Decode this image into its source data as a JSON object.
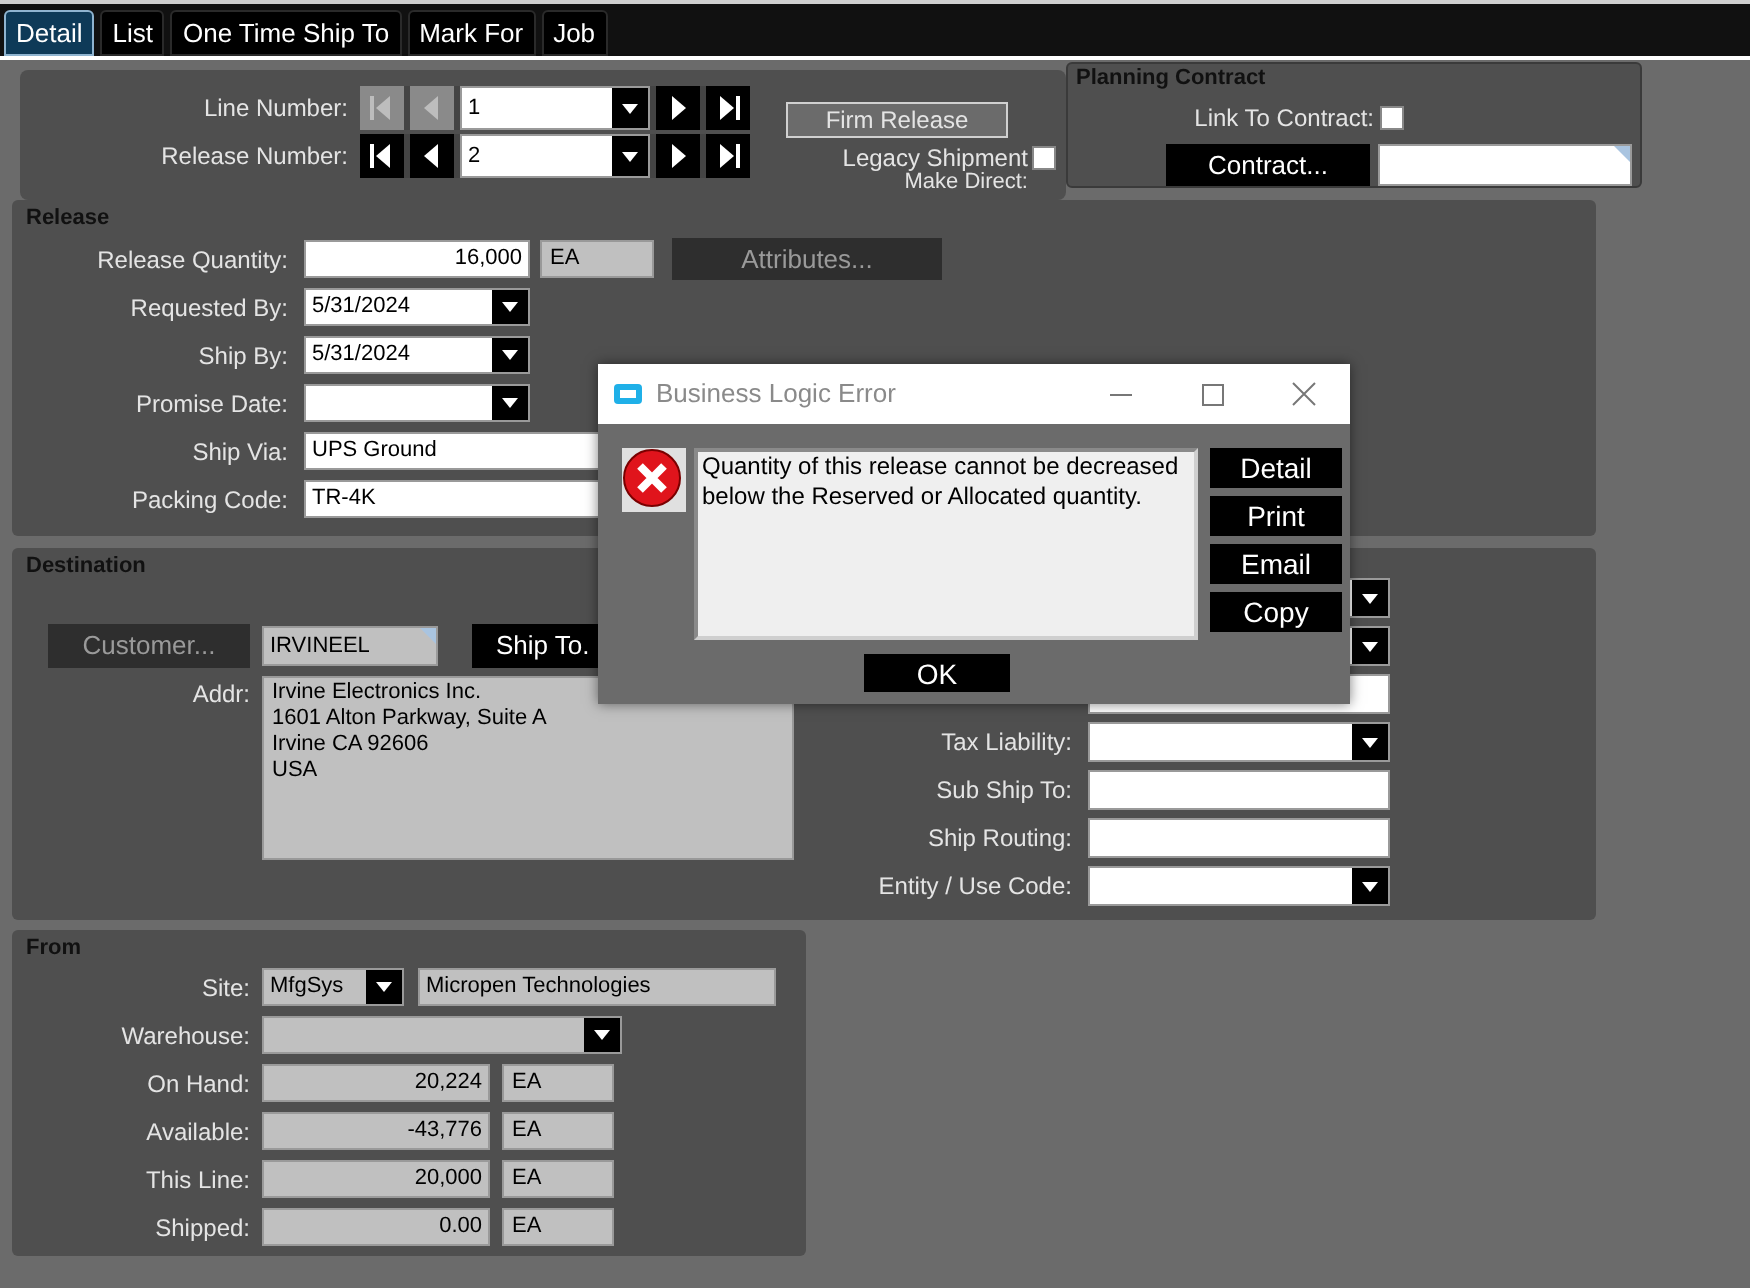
{
  "tabs": [
    {
      "label": "Detail",
      "selected": true
    },
    {
      "label": "List",
      "selected": false
    },
    {
      "label": "One Time Ship To",
      "selected": false
    },
    {
      "label": "Mark For",
      "selected": false
    },
    {
      "label": "Job",
      "selected": false
    }
  ],
  "header": {
    "navigators": [
      {
        "label": "Line Number:",
        "value": "1",
        "first_disabled": true
      },
      {
        "label": "Release Number:",
        "value": "2",
        "first_disabled": false
      }
    ],
    "firm_release_button": "Firm Release",
    "legacy_shipment": {
      "label": "Legacy Shipment",
      "checked": false
    },
    "make_direct_label": "Make Direct:"
  },
  "planning_contract": {
    "title": "Planning Contract",
    "link_to_contract": {
      "label": "Link To Contract:",
      "checked": false
    },
    "contract_button": "Contract..."
  },
  "release": {
    "title": "Release",
    "attributes_button": {
      "label": "Attributes...",
      "disabled": true
    },
    "rows": [
      {
        "kind": "quantity",
        "label": "Release Quantity:",
        "value": "16,000",
        "unit": "EA"
      },
      {
        "kind": "combo",
        "label": "Requested By:",
        "value": "5/31/2024"
      },
      {
        "kind": "combo",
        "label": "Ship By:",
        "value": "5/31/2024"
      },
      {
        "kind": "combo",
        "label": "Promise Date:"
      },
      {
        "kind": "text",
        "label": "Ship Via:",
        "value": "UPS Ground"
      },
      {
        "kind": "text",
        "label": "Packing Code:",
        "value": "TR-4K"
      }
    ]
  },
  "destination": {
    "title": "Destination",
    "customer_button": {
      "label": "Customer...",
      "disabled": true
    },
    "customer_id": "IRVINEEL",
    "ship_to_button": "Ship To.",
    "address_label": "Addr:",
    "address": [
      "Irvine Electronics Inc.",
      "1601 Alton Parkway, Suite A",
      "Irvine CA 92606",
      "USA"
    ],
    "right_fields": [
      {
        "kind": "combo"
      },
      {
        "kind": "combo"
      },
      {
        "kind": "text"
      },
      {
        "kind": "combo",
        "label": "Tax Liability:"
      },
      {
        "kind": "text",
        "label": "Sub Ship To:"
      },
      {
        "kind": "text",
        "label": "Ship Routing:"
      },
      {
        "kind": "combo",
        "label": "Entity / Use Code:"
      }
    ]
  },
  "from": {
    "title": "From",
    "site": {
      "label": "Site:",
      "value": "MfgSys",
      "name": "Micropen Technologies"
    },
    "warehouse_label": "Warehouse:",
    "quantities": [
      {
        "label": "On Hand:",
        "value": "20,224",
        "unit": "EA"
      },
      {
        "label": "Available:",
        "value": "-43,776",
        "unit": "EA"
      },
      {
        "label": "This Line:",
        "value": "20,000",
        "unit": "EA"
      },
      {
        "label": "Shipped:",
        "value": "0.00",
        "unit": "EA"
      }
    ]
  },
  "dialog": {
    "title": "Business Logic Error",
    "message": "Quantity of this release cannot be decreased below the Reserved or Allocated quantity.",
    "buttons": [
      "Detail",
      "Print",
      "Email",
      "Copy"
    ],
    "ok_button": "OK"
  }
}
